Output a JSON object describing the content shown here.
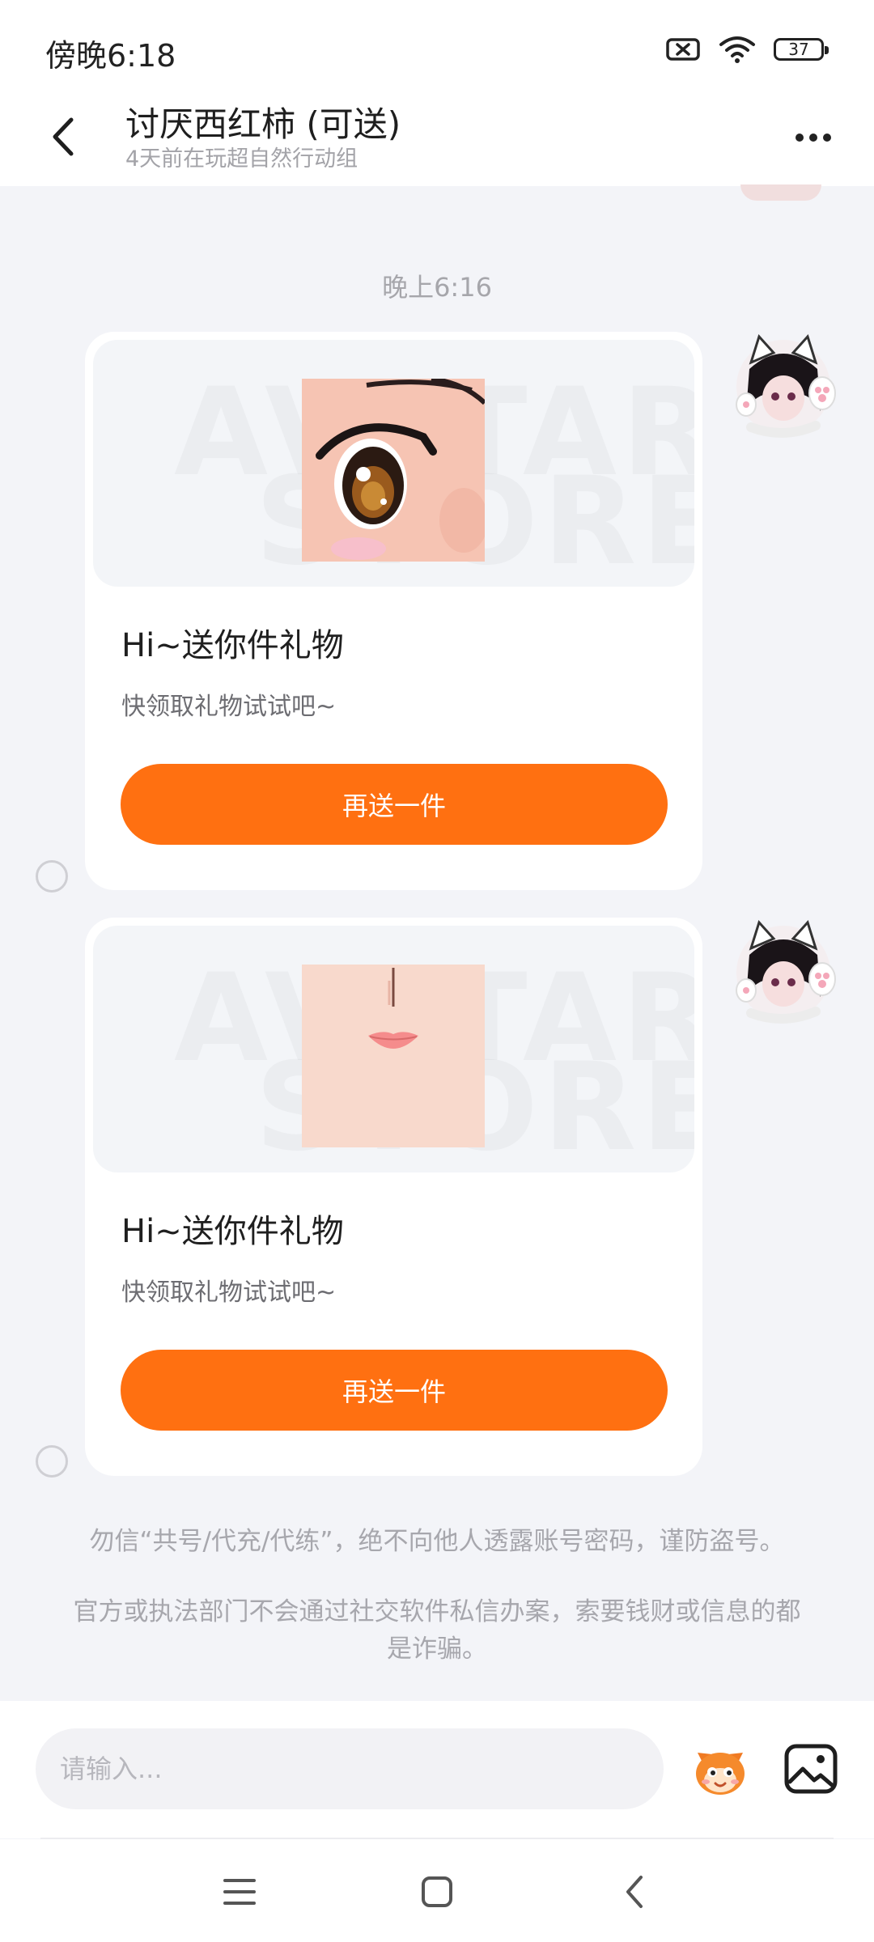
{
  "status_bar": {
    "time": "傍晚6:18",
    "battery": "37",
    "icons": [
      "notification-off-icon",
      "wifi-icon",
      "battery-icon"
    ]
  },
  "header": {
    "title": "讨厌西红柿 (可送)",
    "subtitle": "4天前在玩超自然行动组",
    "back_icon": "back-arrow-icon",
    "more_icon": "more-dots-icon"
  },
  "chat": {
    "time_label": "晚上6:16",
    "messages": [
      {
        "title": "Hi~送你件礼物",
        "desc": "快领取礼物试试吧~",
        "button": "再送一件",
        "watermark_line1": "AVATAR",
        "watermark_line2": "STORE",
        "image_icon": "eye-gift-image"
      },
      {
        "title": "Hi~送你件礼物",
        "desc": "快领取礼物试试吧~",
        "button": "再送一件",
        "watermark_line1": "AVATAR",
        "watermark_line2": "STORE",
        "image_icon": "mouth-gift-image"
      }
    ]
  },
  "warnings": [
    "勿信“共号/代充/代练”，绝不向他人透露账号密码，谨防盗号。",
    "官方或执法部门不会通过社交软件私信办案，索要钱财或信息的都是诈骗。"
  ],
  "input_bar": {
    "placeholder": "请输入...",
    "emoji_icon": "emoji-mascot-icon",
    "image_icon": "image-icon"
  },
  "nav_bar": {
    "icons": [
      "menu-icon",
      "home-icon",
      "back-icon"
    ]
  },
  "colors": {
    "accent": "#FF7011",
    "background": "#F3F4F8"
  }
}
